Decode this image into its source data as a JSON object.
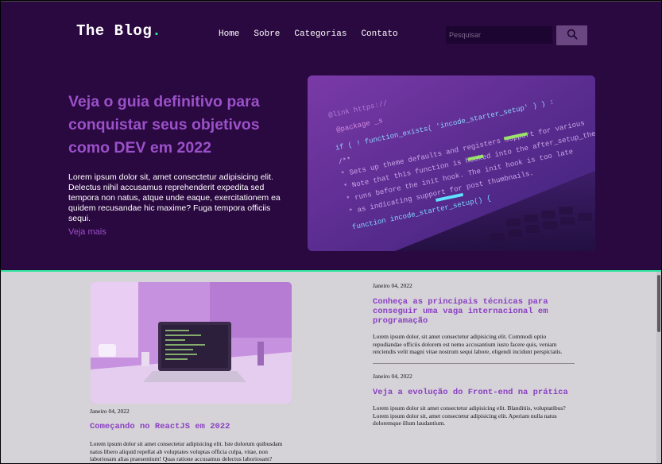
{
  "header": {
    "logo": "The Blog",
    "logo_dot": ".",
    "nav": [
      "Home",
      "Sobre",
      "Categorias",
      "Contato"
    ],
    "search_placeholder": "Pesquisar",
    "search_icon": "search-icon"
  },
  "hero": {
    "title": "Veja o guia definitivo para conquistar seus objetivos como DEV em 2022",
    "text": "Lorem ipsum dolor sit, amet consectetur adipisicing elit. Delectus nihil accusamus reprehenderit expedita sed tempora non natus, atque unde eaque, exercitationem ea quidem recusandae hic maxime? Fuga tempora officiis sequi.",
    "link": "Veja mais",
    "code_lines": [
      "@link https://",
      "@package _s",
      "if ( ! function_exists( 'incode_starter_setup' ) ) :",
      "/**",
      " * Sets up theme defaults and registers support for various",
      " * Note that this function is hooked into the after_setup_theme",
      " * runs before the init hook. The init hook is too late",
      " * as indicating support for post thumbnails.",
      "function incode_starter_setup() {"
    ]
  },
  "feature": {
    "date": "Janeiro 04, 2022",
    "title": "Começando no ReactJS em 2022",
    "text": "Lorem ipsum dolor sit amet consectetur adipisicing elit. Iste dolorum quibusdam natus libero aliquid repellat ab voluptates voluptas officia culpa, vitae, non laboriosam alias praesentium! Quas ratione accusamus delectus laboriosam?"
  },
  "posts": [
    {
      "date": "Janeiro 04, 2022",
      "title": "Conheça as principais técnicas para conseguir uma vaga internacional em programação",
      "text": "Lorem ipsum dolor, sit amet consectetur adipisicing elit. Commodi optio repudiandae officiis dolorem est nemo accusantium iusto facere quis, veniam reiciendis velit magni vitae nostrum sequi labore, eligendi incidunt perspiciatis."
    },
    {
      "date": "Janeiro 04, 2022",
      "title": "Veja a evolução do Front-end na prática",
      "text": "Lorem ipsum dolor sit amet consectetur adipisicing elit. Blanditiis, voluptatibus? Lorem ipsum dolor sit, amet consectetur adipisicing elit. Aperiam nulla natus doloremque illum laudantium."
    }
  ],
  "colors": {
    "header_bg": "#2a0840",
    "accent": "#9b51c9",
    "accent_green": "#2ee59d",
    "content_bg": "#d6d3d8"
  }
}
